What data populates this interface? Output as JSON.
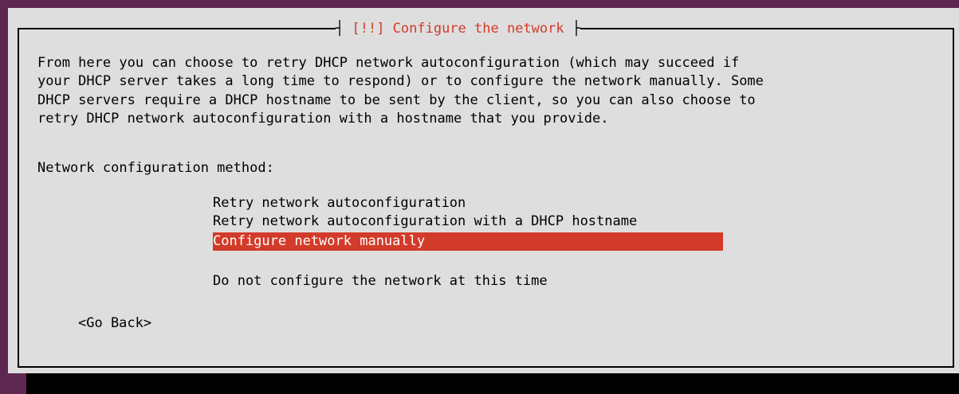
{
  "dialog": {
    "title": "[!!] Configure the network",
    "title_left": "┤ ",
    "title_right": " ├",
    "description": "From here you can choose to retry DHCP network autoconfiguration (which may succeed if\nyour DHCP server takes a long time to respond) or to configure the network manually. Some\nDHCP servers require a DHCP hostname to be sent by the client, so you can also choose to\nretry DHCP network autoconfiguration with a hostname that you provide.",
    "prompt_label": "Network configuration method:",
    "options": [
      {
        "label": "Retry network autoconfiguration",
        "selected": false
      },
      {
        "label": "Retry network autoconfiguration with a DHCP hostname",
        "selected": false
      },
      {
        "label": "Configure network manually",
        "selected": true
      },
      {
        "label": "Do not configure the network at this time",
        "selected": false
      }
    ],
    "go_back_label": "<Go Back>"
  },
  "colors": {
    "background": "#5e2750",
    "dialog": "#dedede",
    "accent": "#d23b2a"
  }
}
